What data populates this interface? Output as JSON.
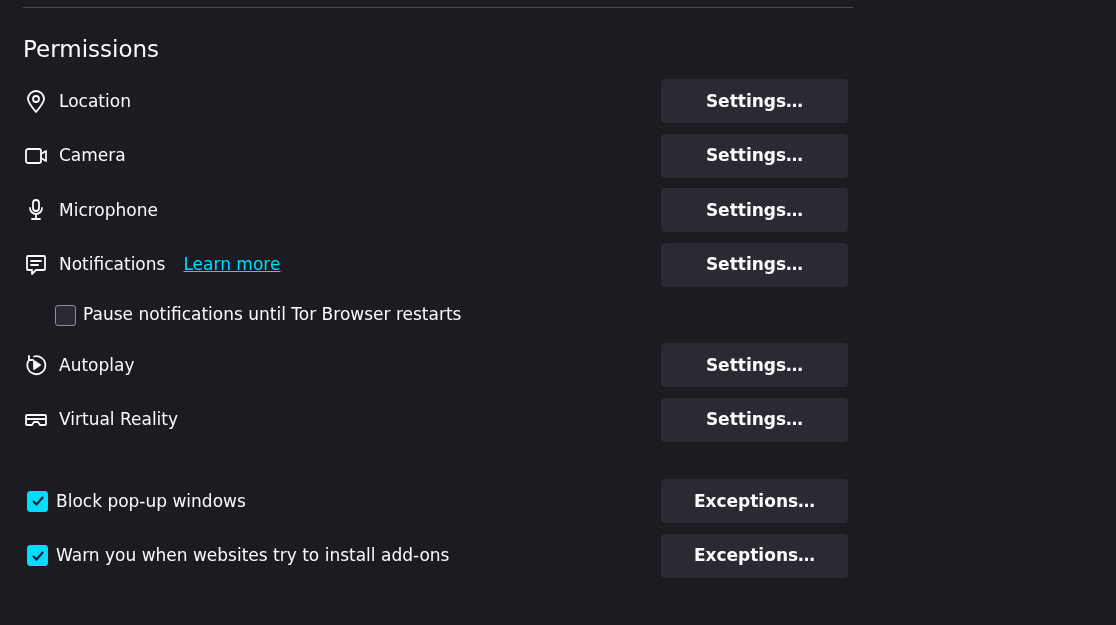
{
  "section": {
    "title": "Permissions"
  },
  "rows": [
    {
      "kind": "permission",
      "label": "Location",
      "button": "Settings…"
    },
    {
      "kind": "permission",
      "label": "Camera",
      "button": "Settings…"
    },
    {
      "kind": "permission",
      "label": "Microphone",
      "button": "Settings…"
    },
    {
      "kind": "permission",
      "label": "Notifications",
      "link": "Learn more",
      "button": "Settings…"
    },
    {
      "kind": "subcheck",
      "label": "Pause notifications until Tor Browser restarts",
      "checked": false
    },
    {
      "kind": "permission",
      "label": "Autoplay",
      "button": "Settings…"
    },
    {
      "kind": "permission",
      "label": "Virtual Reality",
      "button": "Settings…"
    },
    {
      "kind": "check",
      "label": "Block pop-up windows",
      "checked": true,
      "button": "Exceptions…"
    },
    {
      "kind": "check",
      "label": "Warn you when websites try to install add-ons",
      "checked": true,
      "button": "Exceptions…"
    }
  ]
}
